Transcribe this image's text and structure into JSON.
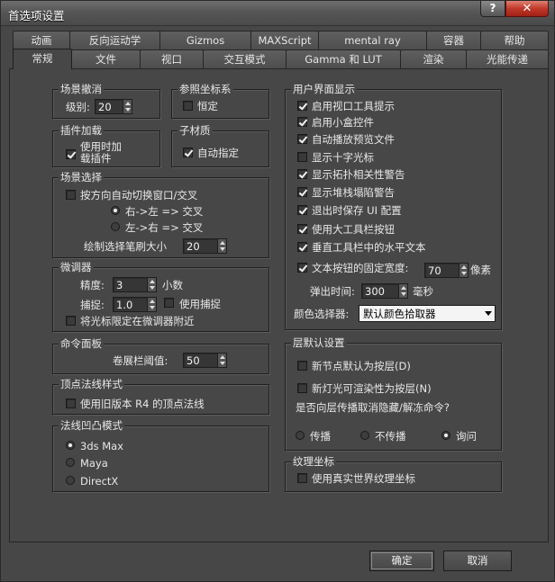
{
  "window": {
    "title": "首选项设置",
    "help_label": "?",
    "close_label": "✕"
  },
  "tabs_row1": [
    "动画",
    "反向运动学",
    "Gizmos",
    "MAXScript",
    "mental ray",
    "容器",
    "帮助"
  ],
  "tabs_row2": [
    "常规",
    "文件",
    "视口",
    "交互模式",
    "Gamma 和 LUT",
    "渲染",
    "光能传递"
  ],
  "active_tab": "常规",
  "scene_undo": {
    "title": "场景撤消",
    "level_label": "级别:",
    "level_value": "20"
  },
  "ref_coords": {
    "title": "参照坐标系",
    "constant_label": "恒定",
    "constant_checked": false
  },
  "plugin_loading": {
    "title": "插件加载",
    "load_on_use_label_1": "使用时加",
    "load_on_use_label_2": "载插件",
    "load_on_use_checked": true
  },
  "sub_materials": {
    "title": "子材质",
    "auto_assign_label": "自动指定",
    "auto_assign_checked": true
  },
  "scene_selection": {
    "title": "场景选择",
    "auto_switch_label": "按方向自动切换窗口/交叉",
    "auto_switch_checked": false,
    "rtl_label": "右->左 => 交叉",
    "rtl_selected": true,
    "ltr_label": "左->右 => 交叉",
    "ltr_selected": false,
    "brush_size_label": "绘制选择笔刷大小",
    "brush_size_value": "20"
  },
  "spinners": {
    "title": "微调器",
    "precision_label": "精度:",
    "precision_value": "3",
    "decimals_label": "小数",
    "snap_label": "捕捉:",
    "snap_value": "1.0",
    "use_snap_label": "使用捕捉",
    "use_snap_checked": false,
    "wrap_cursor_label": "将光标限定在微调器附近",
    "wrap_cursor_checked": false
  },
  "command_panel": {
    "title": "命令面板",
    "rollout_threshold_label": "卷展栏阈值:",
    "rollout_threshold_value": "50"
  },
  "vertex_normal": {
    "title": "顶点法线样式",
    "legacy_r4_label": "使用旧版本 R4 的顶点法线",
    "legacy_r4_checked": false
  },
  "normal_bump": {
    "title": "法线凹凸模式",
    "options": [
      {
        "label": "3ds Max",
        "selected": true
      },
      {
        "label": "Maya",
        "selected": false
      },
      {
        "label": "DirectX",
        "selected": false
      }
    ]
  },
  "ui_display": {
    "title": "用户界面显示",
    "items": [
      {
        "label": "启用视口工具提示",
        "checked": true
      },
      {
        "label": "启用小盒控件",
        "checked": true
      },
      {
        "label": "自动播放预览文件",
        "checked": true
      },
      {
        "label": "显示十字光标",
        "checked": false
      },
      {
        "label": "显示拓扑相关性警告",
        "checked": true
      },
      {
        "label": "显示堆栈塌陷警告",
        "checked": true
      },
      {
        "label": "退出时保存 UI 配置",
        "checked": true
      },
      {
        "label": "使用大工具栏按钮",
        "checked": true
      },
      {
        "label": "垂直工具栏中的水平文本",
        "checked": true
      }
    ],
    "fixed_width_label": "文本按钮的固定宽度:",
    "fixed_width_checked": true,
    "fixed_width_value": "70",
    "fixed_width_unit": "像素",
    "flyout_time_label": "弹出时间:",
    "flyout_time_value": "300",
    "flyout_time_unit": "毫秒",
    "color_picker_label": "颜色选择器:",
    "color_picker_value": "默认颜色拾取器"
  },
  "layer_defaults": {
    "title": "层默认设置",
    "new_nodes_label": "新节点默认为按层(D)",
    "new_nodes_checked": false,
    "new_lights_label": "新灯光可渲染性为按层(N)",
    "new_lights_checked": false,
    "propagate_question": "是否向层传播取消隐藏/解冻命令?",
    "propagate_options": [
      {
        "label": "传播",
        "selected": false
      },
      {
        "label": "不传播",
        "selected": false
      },
      {
        "label": "询问",
        "selected": true
      }
    ]
  },
  "texture_coords": {
    "title": "纹理坐标",
    "real_world_label": "使用真实世界纹理坐标",
    "real_world_checked": false
  },
  "footer": {
    "ok_label": "确定",
    "cancel_label": "取消"
  }
}
